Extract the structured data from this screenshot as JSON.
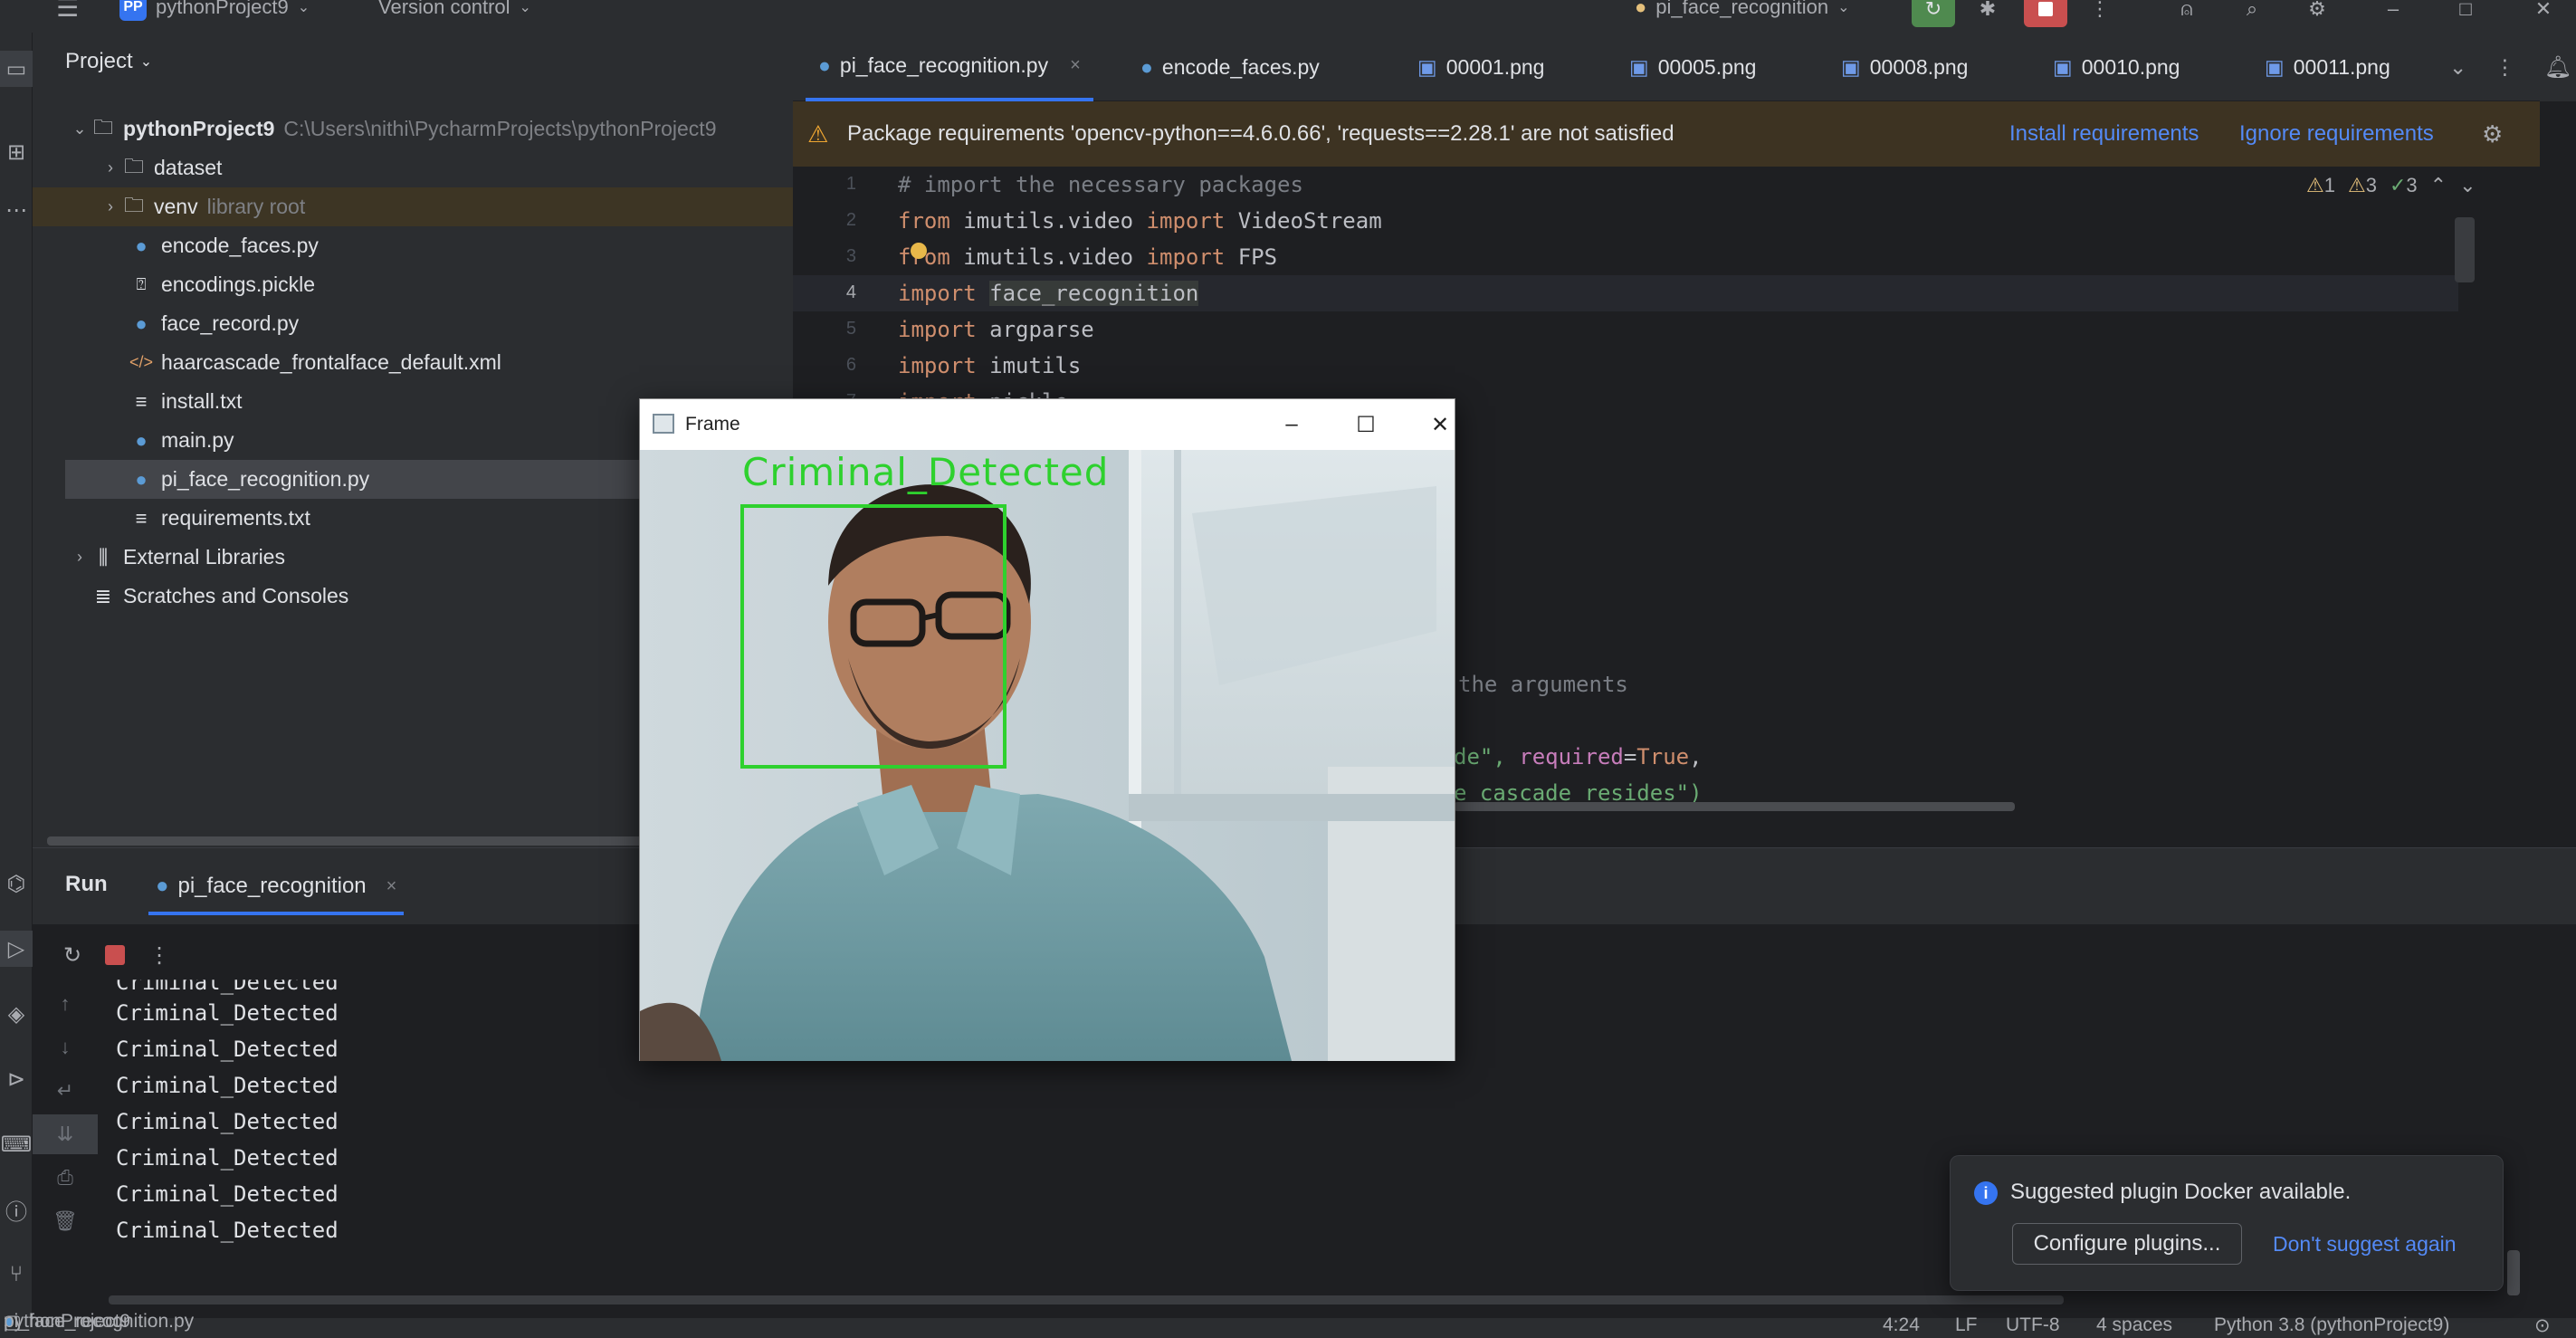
{
  "titlebar": {
    "project_badge": "PP",
    "project_name": "pythonProject9",
    "vcs": "Version control",
    "run_config": "pi_face_recognition"
  },
  "project_panel": {
    "title": "Project",
    "root_name": "pythonProject9",
    "root_path": "C:\\Users\\nithi\\PycharmProjects\\pythonProject9",
    "items": [
      {
        "label": "dataset",
        "kind": "folder"
      },
      {
        "label": "venv",
        "kind": "folder",
        "note": "library root"
      },
      {
        "label": "encode_faces.py",
        "kind": "python"
      },
      {
        "label": "encodings.pickle",
        "kind": "unknown"
      },
      {
        "label": "face_record.py",
        "kind": "python"
      },
      {
        "label": "haarcascade_frontalface_default.xml",
        "kind": "xml"
      },
      {
        "label": "install.txt",
        "kind": "text"
      },
      {
        "label": "main.py",
        "kind": "python"
      },
      {
        "label": "pi_face_recognition.py",
        "kind": "python"
      },
      {
        "label": "requirements.txt",
        "kind": "text"
      }
    ],
    "external_libraries": "External Libraries",
    "scratches": "Scratches and Consoles"
  },
  "tabs": [
    {
      "label": "pi_face_recognition.py",
      "icon": "python-file-icon"
    },
    {
      "label": "encode_faces.py",
      "icon": "python-file-icon"
    },
    {
      "label": "00001.png",
      "icon": "image-file-icon"
    },
    {
      "label": "00005.png",
      "icon": "image-file-icon"
    },
    {
      "label": "00008.png",
      "icon": "image-file-icon"
    },
    {
      "label": "00010.png",
      "icon": "image-file-icon"
    },
    {
      "label": "00011.png",
      "icon": "image-file-icon"
    }
  ],
  "banner": {
    "message": "Package requirements 'opencv-python==4.6.0.66', 'requests==2.28.1' are not satisfied",
    "install": "Install requirements",
    "ignore": "Ignore requirements"
  },
  "inspections": {
    "errors": "1",
    "warnings": "3",
    "ok": "3"
  },
  "editor": {
    "line_numbers": [
      "1",
      "2",
      "3",
      "4",
      "5",
      "6",
      "7"
    ],
    "l1": "# import the necessary packages",
    "l2_kw": "from",
    "l2_mod": " imutils.video ",
    "l2_kw2": "import",
    "l2_name": " VideoStream",
    "l3_kw": "from",
    "l3_mod": " imutils.video ",
    "l3_kw2": "import",
    "l3_name": " FPS",
    "l4_kw": "import",
    "l4_name": "face_recognition",
    "l5_kw": "import",
    "l5_name": " argparse",
    "l6_kw": "import",
    "l6_name": " imutils",
    "l7_kw": "import",
    "l7_name": " pickle",
    "frag1": "the arguments",
    "frag2_a": "de\", ",
    "frag2_b": "required",
    "frag2_c": "=",
    "frag2_d": "True",
    "frag2_e": ",",
    "frag3": "e cascade resides\")"
  },
  "run": {
    "title": "Run",
    "tab": "pi_face_recognition",
    "output": [
      "Criminal_Detected",
      "Criminal_Detected",
      "Criminal_Detected",
      "Criminal_Detected",
      "Criminal_Detected",
      "Criminal_Detected",
      "Criminal_Detected",
      "Criminal_Detected"
    ]
  },
  "frame_window": {
    "title": "Frame",
    "overlay_label": "Criminal_Detected",
    "box_color": "#2ed12e"
  },
  "notification": {
    "message": "Suggested plugin Docker available.",
    "configure": "Configure plugins...",
    "dont_suggest": "Don't suggest again"
  },
  "statusbar": {
    "crumb1": "pythonProject9",
    "crumb2": "pi_face_recognition.py",
    "position": "4:24",
    "line_sep": "LF",
    "encoding": "UTF-8",
    "indent": "4 spaces",
    "interpreter": "Python 3.8 (pythonProject9)"
  },
  "colors": {
    "accent": "#3574f0",
    "keyword": "#cf8e6d",
    "comment": "#7a7e85",
    "string": "#6aab73",
    "stop": "#c94f4f",
    "run_green": "#5fb865"
  }
}
